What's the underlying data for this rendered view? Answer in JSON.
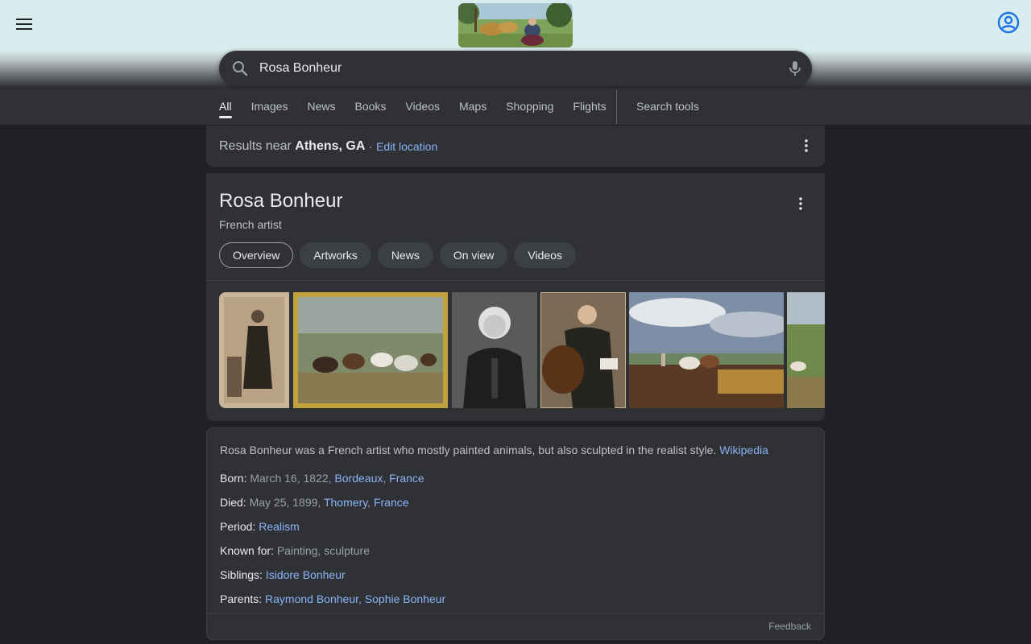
{
  "header": {
    "menu_icon": "hamburger-menu-icon",
    "account_icon": "account-circle-icon",
    "doodle_icon": "doodle-logo"
  },
  "search": {
    "query": "Rosa Bonheur",
    "search_icon": "search-icon",
    "mic_icon": "microphone-icon"
  },
  "tabs": {
    "items": [
      "All",
      "Images",
      "News",
      "Books",
      "Videos",
      "Maps",
      "Shopping",
      "Flights"
    ],
    "active": "All",
    "search_tools": "Search tools"
  },
  "location": {
    "prefix": "Results near",
    "place": "Athens, GA",
    "separator": "·",
    "edit_link": "Edit location"
  },
  "knowledge_panel": {
    "title": "Rosa Bonheur",
    "subtitle": "French artist",
    "chips": [
      "Overview",
      "Artworks",
      "News",
      "On view",
      "Videos"
    ],
    "active_chip": "Overview"
  },
  "info": {
    "description": "Rosa Bonheur was a French artist who mostly painted animals, but also sculpted in the realist style.",
    "description_link": "Wikipedia",
    "facts": [
      {
        "label": "Born:",
        "value": "March 16, 1822,",
        "links": [
          "Bordeaux",
          "France"
        ]
      },
      {
        "label": "Died:",
        "value": "May 25, 1899,",
        "links": [
          "Thomery",
          "France"
        ]
      },
      {
        "label": "Period:",
        "value": "",
        "links": [
          "Realism"
        ]
      },
      {
        "label": "Known for:",
        "value": "Painting, sculpture",
        "links": []
      },
      {
        "label": "Siblings:",
        "value": "",
        "links": [
          "Isidore Bonheur"
        ]
      },
      {
        "label": "Parents:",
        "value": "",
        "links": [
          "Raymond Bonheur",
          "Sophie Bonheur"
        ]
      }
    ],
    "feedback": "Feedback"
  },
  "colors": {
    "background": "#202124",
    "card": "#303134",
    "link": "#8ab4f8",
    "text": "#e8eaed",
    "muted": "#bdc1c6"
  }
}
